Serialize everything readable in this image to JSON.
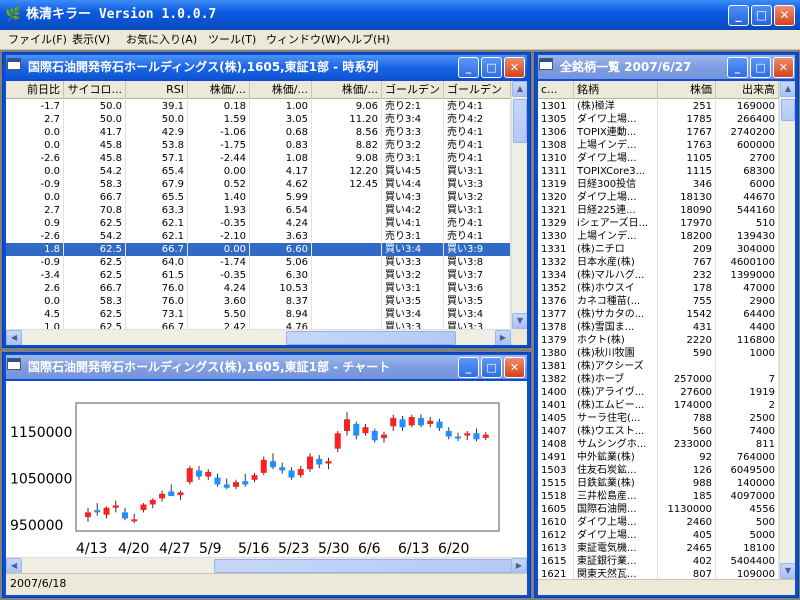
{
  "app": {
    "title": "株清キラー Version 1.0.0.7",
    "menu": [
      "ファイル(F)",
      "表示(V)",
      "お気に入り(A)",
      "ツール(T)",
      "ウィンドウ(W)",
      "ヘルプ(H)"
    ],
    "minimize": "_",
    "maximize": "□",
    "close": "✕"
  },
  "timeseries_window": {
    "title": "国際石油開発帝石ホールディングス(株),1605,東証1部 - 時系列",
    "headers": [
      "前日比",
      "サイコロ...",
      "RSI",
      "株価/...",
      "株価/...",
      "株価/...",
      "ゴールデン",
      "ゴールデン"
    ],
    "selected_index": 11,
    "rows": [
      [
        "-1.7",
        "50.0",
        "39.1",
        "0.18",
        "1.00",
        "9.06",
        "売り2:1",
        "売り4:1"
      ],
      [
        "2.7",
        "50.0",
        "50.0",
        "1.59",
        "3.05",
        "11.20",
        "売り3:4",
        "売り4:2"
      ],
      [
        "0.0",
        "41.7",
        "42.9",
        "-1.06",
        "0.68",
        "8.56",
        "売り3:3",
        "売り4:1"
      ],
      [
        "0.0",
        "45.8",
        "53.8",
        "-1.75",
        "0.83",
        "8.82",
        "売り3:2",
        "売り4:1"
      ],
      [
        "-2.6",
        "45.8",
        "57.1",
        "-2.44",
        "1.08",
        "9.08",
        "売り3:1",
        "売り4:1"
      ],
      [
        "0.0",
        "54.2",
        "65.4",
        "0.00",
        "4.17",
        "12.20",
        "買い4:5",
        "買い3:1"
      ],
      [
        "-0.9",
        "58.3",
        "67.9",
        "0.52",
        "4.62",
        "12.45",
        "買い4:4",
        "買い3:3"
      ],
      [
        "0.0",
        "66.7",
        "65.5",
        "1.40",
        "5.99",
        "",
        "買い4:3",
        "買い3:2"
      ],
      [
        "2.7",
        "70.8",
        "63.3",
        "1.93",
        "6.54",
        "",
        "買い4:2",
        "買い3:1"
      ],
      [
        "0.9",
        "62.5",
        "62.1",
        "-0.35",
        "4.24",
        "",
        "買い4:1",
        "売り4:1"
      ],
      [
        "-2.6",
        "54.2",
        "62.1",
        "-2.10",
        "3.63",
        "",
        "売り3:1",
        "売り4:1"
      ],
      [
        "1.8",
        "62.5",
        "66.7",
        "0.00",
        "6.60",
        "",
        "買い3:4",
        "買い3:9"
      ],
      [
        "-0.9",
        "62.5",
        "64.0",
        "-1.74",
        "5.06",
        "",
        "買い3:3",
        "買い3:8"
      ],
      [
        "-3.4",
        "62.5",
        "61.5",
        "-0.35",
        "6.30",
        "",
        "買い3:2",
        "買い3:7"
      ],
      [
        "2.6",
        "66.7",
        "76.0",
        "4.24",
        "10.53",
        "",
        "買い3:1",
        "買い3:6"
      ],
      [
        "0.0",
        "58.3",
        "76.0",
        "3.60",
        "8.37",
        "",
        "買い3:5",
        "買い3:5"
      ],
      [
        "4.5",
        "62.5",
        "73.1",
        "5.50",
        "8.94",
        "",
        "買い3:4",
        "買い3:4"
      ],
      [
        "1.0",
        "62.5",
        "66.7",
        "2.42",
        "4.76",
        "",
        "買い3:3",
        "買い3:3"
      ]
    ]
  },
  "chart_window": {
    "title": "国際石油開発帝石ホールディングス(株),1605,東証1部 - チャート",
    "status_date": "2007/6/18"
  },
  "chart_data": {
    "type": "candlestick",
    "y_ticks": [
      950000,
      1050000,
      1150000
    ],
    "ylim": [
      935000,
      1210000
    ],
    "x_tick_labels": [
      "4/13",
      "4/20",
      "4/27",
      "5/9",
      "5/16",
      "5/23",
      "5/30",
      "6/6",
      "6/13",
      "6/20"
    ],
    "up_color": "#ff2020",
    "down_color": "#1e90ff",
    "candles": [
      {
        "o": 965000,
        "h": 985000,
        "l": 955000,
        "c": 975000
      },
      {
        "o": 980000,
        "h": 995000,
        "l": 968000,
        "c": 975000
      },
      {
        "o": 970000,
        "h": 988000,
        "l": 962000,
        "c": 985000
      },
      {
        "o": 985000,
        "h": 1000000,
        "l": 975000,
        "c": 990000
      },
      {
        "o": 975000,
        "h": 985000,
        "l": 958000,
        "c": 962000
      },
      {
        "o": 958000,
        "h": 972000,
        "l": 952000,
        "c": 960000
      },
      {
        "o": 980000,
        "h": 995000,
        "l": 975000,
        "c": 992000
      },
      {
        "o": 992000,
        "h": 1005000,
        "l": 984000,
        "c": 1002000
      },
      {
        "o": 1005000,
        "h": 1022000,
        "l": 998000,
        "c": 1015000
      },
      {
        "o": 1020000,
        "h": 1035000,
        "l": 1012000,
        "c": 1010000
      },
      {
        "o": 1012000,
        "h": 1022000,
        "l": 1002000,
        "c": 1018000
      },
      {
        "o": 1040000,
        "h": 1075000,
        "l": 1035000,
        "c": 1070000
      },
      {
        "o": 1065000,
        "h": 1075000,
        "l": 1045000,
        "c": 1052000
      },
      {
        "o": 1052000,
        "h": 1068000,
        "l": 1045000,
        "c": 1062000
      },
      {
        "o": 1050000,
        "h": 1058000,
        "l": 1030000,
        "c": 1035000
      },
      {
        "o": 1035000,
        "h": 1048000,
        "l": 1025000,
        "c": 1028000
      },
      {
        "o": 1030000,
        "h": 1045000,
        "l": 1025000,
        "c": 1040000
      },
      {
        "o": 1042000,
        "h": 1058000,
        "l": 1030000,
        "c": 1035000
      },
      {
        "o": 1045000,
        "h": 1060000,
        "l": 1040000,
        "c": 1055000
      },
      {
        "o": 1060000,
        "h": 1095000,
        "l": 1055000,
        "c": 1088000
      },
      {
        "o": 1085000,
        "h": 1102000,
        "l": 1068000,
        "c": 1072000
      },
      {
        "o": 1072000,
        "h": 1082000,
        "l": 1058000,
        "c": 1065000
      },
      {
        "o": 1065000,
        "h": 1072000,
        "l": 1045000,
        "c": 1050000
      },
      {
        "o": 1055000,
        "h": 1075000,
        "l": 1050000,
        "c": 1068000
      },
      {
        "o": 1068000,
        "h": 1102000,
        "l": 1062000,
        "c": 1095000
      },
      {
        "o": 1090000,
        "h": 1098000,
        "l": 1070000,
        "c": 1078000
      },
      {
        "o": 1080000,
        "h": 1092000,
        "l": 1068000,
        "c": 1085000
      },
      {
        "o": 1112000,
        "h": 1150000,
        "l": 1105000,
        "c": 1145000
      },
      {
        "o": 1150000,
        "h": 1190000,
        "l": 1140000,
        "c": 1175000
      },
      {
        "o": 1165000,
        "h": 1170000,
        "l": 1132000,
        "c": 1140000
      },
      {
        "o": 1145000,
        "h": 1165000,
        "l": 1140000,
        "c": 1158000
      },
      {
        "o": 1150000,
        "h": 1155000,
        "l": 1125000,
        "c": 1130000
      },
      {
        "o": 1135000,
        "h": 1148000,
        "l": 1125000,
        "c": 1142000
      },
      {
        "o": 1160000,
        "h": 1185000,
        "l": 1150000,
        "c": 1178000
      },
      {
        "o": 1175000,
        "h": 1182000,
        "l": 1150000,
        "c": 1158000
      },
      {
        "o": 1162000,
        "h": 1185000,
        "l": 1158000,
        "c": 1180000
      },
      {
        "o": 1178000,
        "h": 1186000,
        "l": 1158000,
        "c": 1162000
      },
      {
        "o": 1165000,
        "h": 1180000,
        "l": 1158000,
        "c": 1172000
      },
      {
        "o": 1170000,
        "h": 1176000,
        "l": 1150000,
        "c": 1156000
      },
      {
        "o": 1150000,
        "h": 1158000,
        "l": 1132000,
        "c": 1138000
      },
      {
        "o": 1138000,
        "h": 1146000,
        "l": 1128000,
        "c": 1135000
      },
      {
        "o": 1140000,
        "h": 1150000,
        "l": 1130000,
        "c": 1145000
      },
      {
        "o": 1145000,
        "h": 1155000,
        "l": 1128000,
        "c": 1132000
      },
      {
        "o": 1135000,
        "h": 1148000,
        "l": 1130000,
        "c": 1142000
      }
    ]
  },
  "list_window": {
    "title": "全銘柄一覧 2007/6/27",
    "headers": [
      "c...",
      "銘柄",
      "株価",
      "出来高"
    ],
    "rows": [
      [
        "1301",
        "(株)極洋",
        "251",
        "169000"
      ],
      [
        "1305",
        "ダイワ上場...",
        "1785",
        "266400"
      ],
      [
        "1306",
        "TOPIX連動...",
        "1767",
        "2740200"
      ],
      [
        "1308",
        "上場インデ...",
        "1763",
        "600000"
      ],
      [
        "1310",
        "ダイワ上場...",
        "1105",
        "2700"
      ],
      [
        "1311",
        "TOPIXCore3...",
        "1115",
        "68300"
      ],
      [
        "1319",
        "日経300投信",
        "346",
        "6000"
      ],
      [
        "1320",
        "ダイワ上場...",
        "18130",
        "44670"
      ],
      [
        "1321",
        "日経225連...",
        "18090",
        "544160"
      ],
      [
        "1329",
        "iシェアーズ日...",
        "17970",
        "510"
      ],
      [
        "1330",
        "上場インデ...",
        "18200",
        "139430"
      ],
      [
        "1331",
        "(株)ニチロ",
        "209",
        "304000"
      ],
      [
        "1332",
        "日本水産(株)",
        "767",
        "4600100"
      ],
      [
        "1334",
        "(株)マルハグ...",
        "232",
        "1399000"
      ],
      [
        "1352",
        "(株)ホウスイ",
        "178",
        "47000"
      ],
      [
        "1376",
        "カネコ種苗(...",
        "755",
        "2900"
      ],
      [
        "1377",
        "(株)サカタの...",
        "1542",
        "64400"
      ],
      [
        "1378",
        "(株)雪国ま...",
        "431",
        "4400"
      ],
      [
        "1379",
        "ホクト(株)",
        "2220",
        "116800"
      ],
      [
        "1380",
        "(株)秋川牧園",
        "590",
        "1000"
      ],
      [
        "1381",
        "(株)アクシーズ",
        "",
        ""
      ],
      [
        "1382",
        "(株)ホーブ",
        "257000",
        "7"
      ],
      [
        "1400",
        "(株)アライヴ...",
        "27600",
        "1919"
      ],
      [
        "1401",
        "(株)エムビー...",
        "174000",
        "2"
      ],
      [
        "1405",
        "サーラ住宅(...",
        "788",
        "2500"
      ],
      [
        "1407",
        "(株)ウエスト...",
        "560",
        "7400"
      ],
      [
        "1408",
        "サムシングホ...",
        "233000",
        "811"
      ],
      [
        "1491",
        "中外鉱業(株)",
        "92",
        "764000"
      ],
      [
        "1503",
        "住友石炭鉱...",
        "126",
        "6049500"
      ],
      [
        "1515",
        "日鉄鉱業(株)",
        "988",
        "140000"
      ],
      [
        "1518",
        "三井松島産...",
        "185",
        "4097000"
      ],
      [
        "1605",
        "国際石油開...",
        "1130000",
        "4556"
      ],
      [
        "1610",
        "ダイワ上場...",
        "2460",
        "500"
      ],
      [
        "1612",
        "ダイワ上場...",
        "405",
        "5000"
      ],
      [
        "1613",
        "東証電気機...",
        "2465",
        "18100"
      ],
      [
        "1615",
        "東証銀行業...",
        "402",
        "5404400"
      ],
      [
        "1621",
        "関東天然瓦...",
        "807",
        "109000"
      ]
    ]
  }
}
